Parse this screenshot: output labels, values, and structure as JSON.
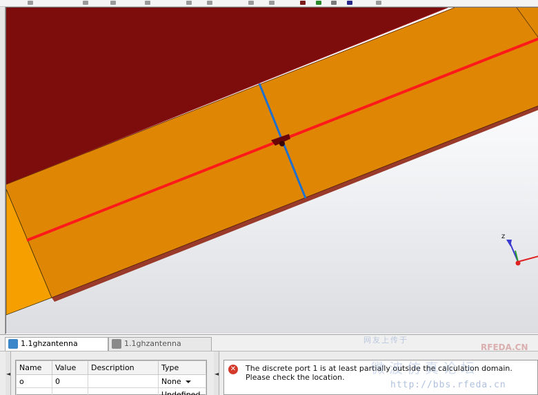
{
  "tabs": [
    {
      "label": "1.1ghzantenna",
      "icon": "3d-view-icon",
      "active": true
    },
    {
      "label": "1.1ghzantenna",
      "icon": "schematic-icon",
      "active": false
    }
  ],
  "viewport": {
    "axis_label": "z"
  },
  "parameters": {
    "headers": [
      "Name",
      "Value",
      "Description",
      "Type"
    ],
    "rows": [
      {
        "name": "o",
        "value": "0",
        "description": "",
        "type": "None"
      },
      {
        "name": "",
        "value": "",
        "description": "",
        "type": "Undefined"
      }
    ]
  },
  "messages": [
    {
      "level": "error",
      "text": "The discrete port 1 is at least partially outside the calculation domain. Please check the location."
    }
  ],
  "watermark": {
    "line1": "网友上传于",
    "line2": "RFEDA.CN",
    "line3": "微波仿真论坛",
    "line4": "http://bbs.rfeda.cn"
  },
  "colors": {
    "background_dark_red": "#7d0c0c",
    "substrate_orange": "#df8605",
    "feed_line": "#ff1a1a",
    "port_line": "#1d6fd0"
  }
}
